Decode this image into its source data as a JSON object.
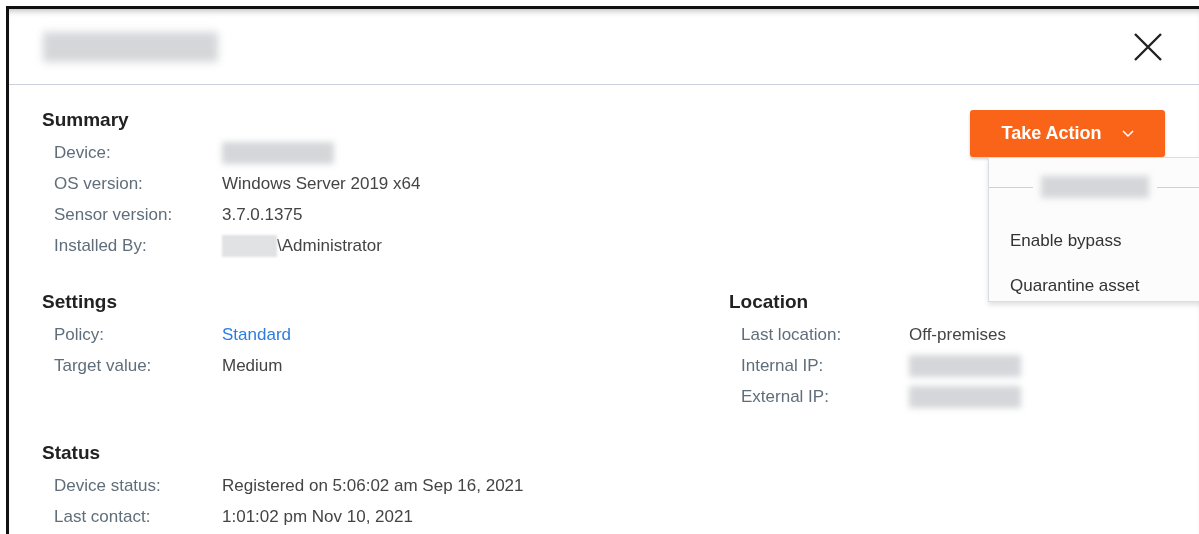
{
  "action_button": {
    "label": "Take Action",
    "expanded": true
  },
  "action_menu": [
    {
      "label": "Enable bypass"
    },
    {
      "label": "Quarantine asset"
    }
  ],
  "sections": [
    {
      "title": "Summary",
      "rows": [
        {
          "label": "Device:",
          "redacted": true
        },
        {
          "label": "OS version:",
          "value": "Windows Server 2019 x64",
          "redacted": false,
          "kind": "text"
        },
        {
          "label": "Sensor version:",
          "value": "3.7.0.1375",
          "redacted": false,
          "kind": "text"
        },
        {
          "label": "Installed By:",
          "value": "\\Administrator",
          "redacted": true,
          "kind": "text"
        }
      ]
    },
    {
      "title": "Settings",
      "rows": [
        {
          "label": "Policy:",
          "value": "Standard",
          "redacted": false,
          "kind": "link"
        },
        {
          "label": "Target value:",
          "value": "Medium",
          "redacted": false,
          "kind": "text"
        }
      ]
    },
    {
      "title": "Location",
      "rows": [
        {
          "label": "Last location:",
          "value": "Off-premises",
          "redacted": false,
          "kind": "text"
        },
        {
          "label": "Internal IP:",
          "redacted": true
        },
        {
          "label": "External IP:",
          "redacted": true
        }
      ]
    },
    {
      "title": "Status",
      "rows": [
        {
          "label": "Device status:",
          "value": "Registered on 5:06:02 am Sep 16, 2021",
          "redacted": false,
          "kind": "text"
        },
        {
          "label": "Last contact:",
          "value": "1:01:02 pm Nov 10, 2021",
          "redacted": false,
          "kind": "text"
        }
      ]
    }
  ]
}
